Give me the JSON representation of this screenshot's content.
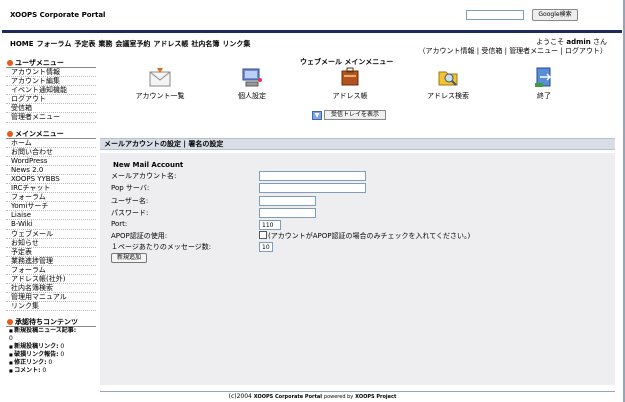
{
  "header": {
    "site_title": "XOOPS Corporate Portal",
    "search_placeholder": "",
    "search_button": "Google検索"
  },
  "topnav": {
    "items": [
      "HOME",
      "フォーラム",
      "予定表",
      "業務",
      "会議室予約",
      "アドレス帳",
      "社内名簿",
      "リンク集"
    ]
  },
  "welcome": {
    "prefix": "ようこそ",
    "user": "admin",
    "suffix": "さん",
    "links_line1": "（アカウント情報 | 受信箱 |",
    "links_line2": "管理者メニュー | ログアウト）"
  },
  "sidebar": {
    "user_menu": {
      "title": "ユーザメニュー",
      "items": [
        "アカウント情報",
        "アカウント編集",
        "イベント通知機能",
        "ログアウト",
        "受信箱",
        "管理者メニュー"
      ]
    },
    "main_menu": {
      "title": "メインメニュー",
      "items": [
        "ホーム",
        "お問い合わせ",
        "WordPress",
        "News 2.0",
        "XOOPS YYBBS",
        "IRCチャット",
        "フォーラム",
        "Yomiサーチ",
        "Liaise",
        "B-Wiki",
        "ウェブメール",
        "お知らせ",
        "予定表",
        "業務進捗管理",
        "フォーラム",
        "アドレス帳(社外)",
        "社内名簿検索",
        "管理用マニュアル",
        "リンク集"
      ]
    },
    "pending": {
      "title": "承認待ちコンテンツ",
      "items": [
        {
          "label": "新規投稿ニュース記事:",
          "value": "0"
        },
        {
          "label": "新規投稿リンク:",
          "value": "0"
        },
        {
          "label": "破損リンク報告:",
          "value": "0"
        },
        {
          "label": "修正リンク:",
          "value": "0"
        },
        {
          "label": "コメント:",
          "value": "0"
        }
      ]
    }
  },
  "main": {
    "title": "ウェブメール メインメニュー",
    "icons": [
      {
        "label": "アカウント一覧",
        "icon": "mail-envelope-icon"
      },
      {
        "label": "個人設定",
        "icon": "computer-icon"
      },
      {
        "label": "アドレス帳",
        "icon": "address-book-icon"
      },
      {
        "label": "アドレス検索",
        "icon": "address-search-icon"
      },
      {
        "label": "終了",
        "icon": "exit-door-icon"
      }
    ],
    "tray_button": "受信トレイを表示",
    "section_bar": "メールアカウントの設定 | 署名の設定",
    "form": {
      "heading": "New Mail Account",
      "account_name_label": "メールアカウント名:",
      "pop_server_label": "Pop サーバ:",
      "username_label": "ユーザー名:",
      "password_label": "パスワード:",
      "port_label": "Port:",
      "port_value": "110",
      "apop_label": "APOP認証の使用:",
      "apop_note": "(アカウントがAPOP認証の場合のみチェックを入れてください。)",
      "per_page_label": "１ページあたりのメッセージ数:",
      "per_page_value": "10",
      "add_button": "新規追加"
    }
  },
  "footer": {
    "copyright": "(c)2004",
    "portal": "XOOPS Corporate Portal",
    "powered": "powered by",
    "project": "XOOPS Project"
  },
  "colors": {
    "header_rule": "#1c2c5e",
    "bullet": "#e85a1a",
    "section_bar": "#d9dde5",
    "form_bg": "#eeeef0"
  }
}
